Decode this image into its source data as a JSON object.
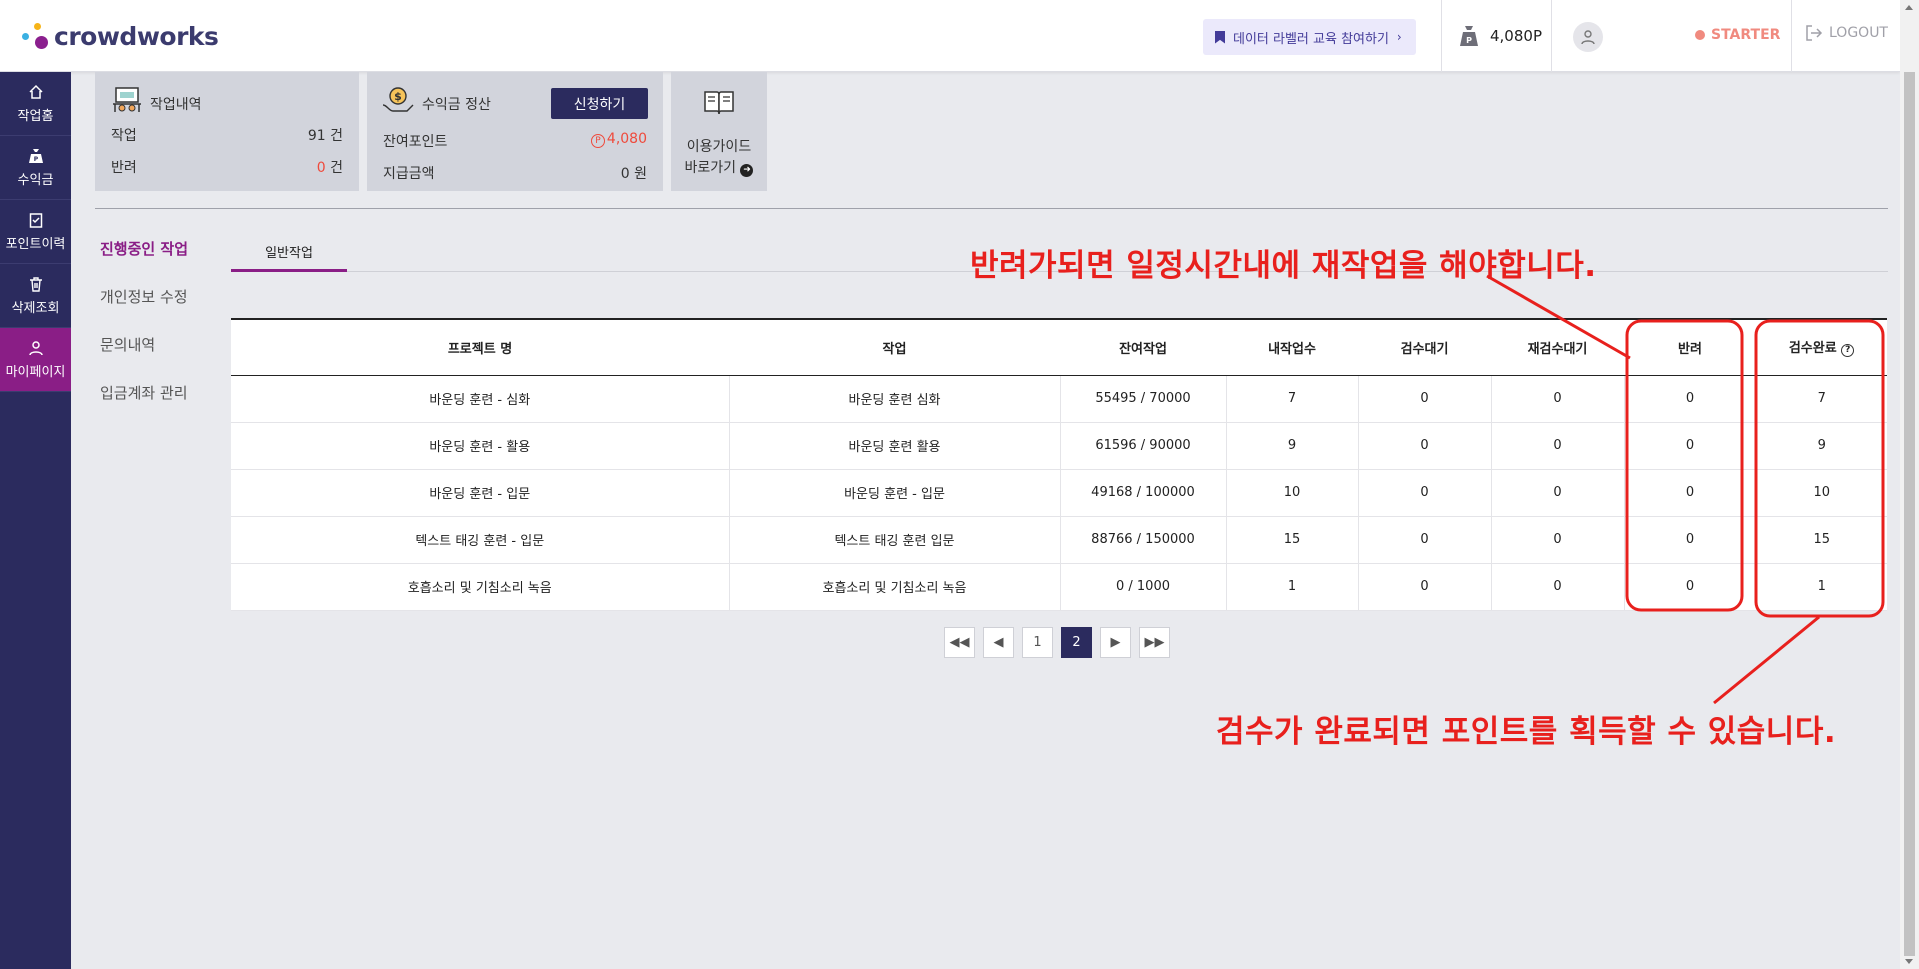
{
  "header": {
    "logo": "crowdworks",
    "edu_button": "데이터 라벨러 교육 참여하기",
    "points": "4,080P",
    "level": "STARTER",
    "logout": "LOGOUT"
  },
  "sidebar": {
    "items": [
      {
        "label": "작업홈",
        "icon": "home-icon"
      },
      {
        "label": "수익금",
        "icon": "money-bag-icon"
      },
      {
        "label": "포인트이력",
        "icon": "clipboard-icon"
      },
      {
        "label": "삭제조회",
        "icon": "trash-icon"
      },
      {
        "label": "마이페이지",
        "icon": "person-icon"
      }
    ]
  },
  "summary": {
    "work": {
      "title": "작업내역",
      "rows": [
        {
          "label": "작업",
          "value": "91",
          "unit": "건"
        },
        {
          "label": "반려",
          "value": "0",
          "unit": "건"
        }
      ]
    },
    "earnings": {
      "title": "수익금 정산",
      "apply": "신청하기",
      "rows": [
        {
          "label": "잔여포인트",
          "value": "4,080"
        },
        {
          "label": "지급금액",
          "value": "0 원"
        }
      ]
    },
    "guide": {
      "line1": "이용가이드",
      "line2": "바로가기"
    }
  },
  "submenu": [
    "진행중인 작업",
    "개인정보 수정",
    "문의내역",
    "입금계좌 관리"
  ],
  "tabs": [
    "일반작업"
  ],
  "table": {
    "columns": [
      "프로젝트 명",
      "작업",
      "잔여작업",
      "내작업수",
      "검수대기",
      "재검수대기",
      "반려",
      "검수완료"
    ],
    "rows": [
      [
        "바운딩 훈련 - 심화",
        "바운딩 훈련 심화",
        "55495 / 70000",
        "7",
        "0",
        "0",
        "0",
        "7"
      ],
      [
        "바운딩 훈련 - 활용",
        "바운딩 훈련 활용",
        "61596 / 90000",
        "9",
        "0",
        "0",
        "0",
        "9"
      ],
      [
        "바운딩 훈련 - 입문",
        "바운딩 훈련 - 입문",
        "49168 / 100000",
        "10",
        "0",
        "0",
        "0",
        "10"
      ],
      [
        "텍스트 태깅 훈련 - 입문",
        "텍스트 태깅 훈련 입문",
        "88766 / 150000",
        "15",
        "0",
        "0",
        "0",
        "15"
      ],
      [
        "호흡소리 및 기침소리 녹음",
        "호흡소리 및 기침소리 녹음",
        "0 / 1000",
        "1",
        "0",
        "0",
        "0",
        "1"
      ]
    ]
  },
  "pagination": {
    "pages": [
      "1",
      "2"
    ],
    "current": "2"
  },
  "annotations": {
    "reject_note": "반려가되면 일정시간내에 재작업을 해야합니다.",
    "complete_note": "검수가 완료되면 포인트를 획득할 수 있습니다."
  },
  "colors": {
    "brand_navy": "#2b2b5e",
    "brand_purple": "#8a1e86",
    "annotation_red": "#e8201d"
  }
}
